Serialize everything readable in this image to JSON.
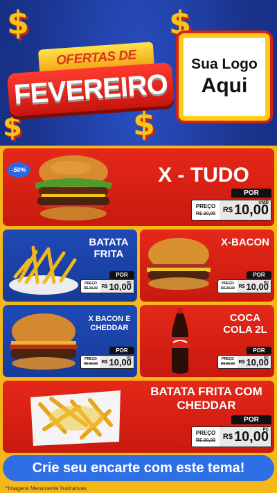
{
  "headline": {
    "line1": "OFERTAS DE",
    "line2": "FEVEREIRO"
  },
  "logo": {
    "line1": "Sua Logo",
    "line2": "Aqui"
  },
  "discount_badge": "-50%",
  "products": [
    {
      "name": "X - TUDO",
      "por": "POR",
      "preco_label": "PREÇO",
      "old_price": "R$ 20,00",
      "currency": "R$",
      "price": "10,00",
      "unit": "UNID"
    },
    {
      "name": "BATATA FRITA",
      "por": "POR",
      "preco_label": "PREÇO",
      "old_price": "R$ 20,00",
      "currency": "R$",
      "price": "10,00",
      "unit": "PÇ"
    },
    {
      "name": "X-BACON",
      "por": "POR",
      "preco_label": "PREÇO",
      "old_price": "R$ 20,00",
      "currency": "R$",
      "price": "10,00",
      "unit": "PÇ"
    },
    {
      "name": "X BACON E CHEDDAR",
      "por": "POR",
      "preco_label": "PREÇO",
      "old_price": "R$ 20,00",
      "currency": "R$",
      "price": "10,00",
      "unit": "PÇ"
    },
    {
      "name": "COCA COLA 2L",
      "por": "POR",
      "preco_label": "PREÇO",
      "old_price": "R$ 20,00",
      "currency": "R$",
      "price": "10,00",
      "unit": "PÇ"
    },
    {
      "name": "BATATA FRITA COM CHEDDAR",
      "por": "POR",
      "preco_label": "PREÇO",
      "old_price": "R$ 20,00",
      "currency": "R$",
      "price": "10,00",
      "unit": "PÇ"
    }
  ],
  "cta": "Crie seu encarte com este tema!",
  "footer": "*Imagens Meramente Ilustrativas",
  "colors": {
    "blue_bg": "#1d3a9a",
    "yellow": "#f6b818",
    "red": "#d8200f",
    "card_blue": "#1f49b5"
  }
}
